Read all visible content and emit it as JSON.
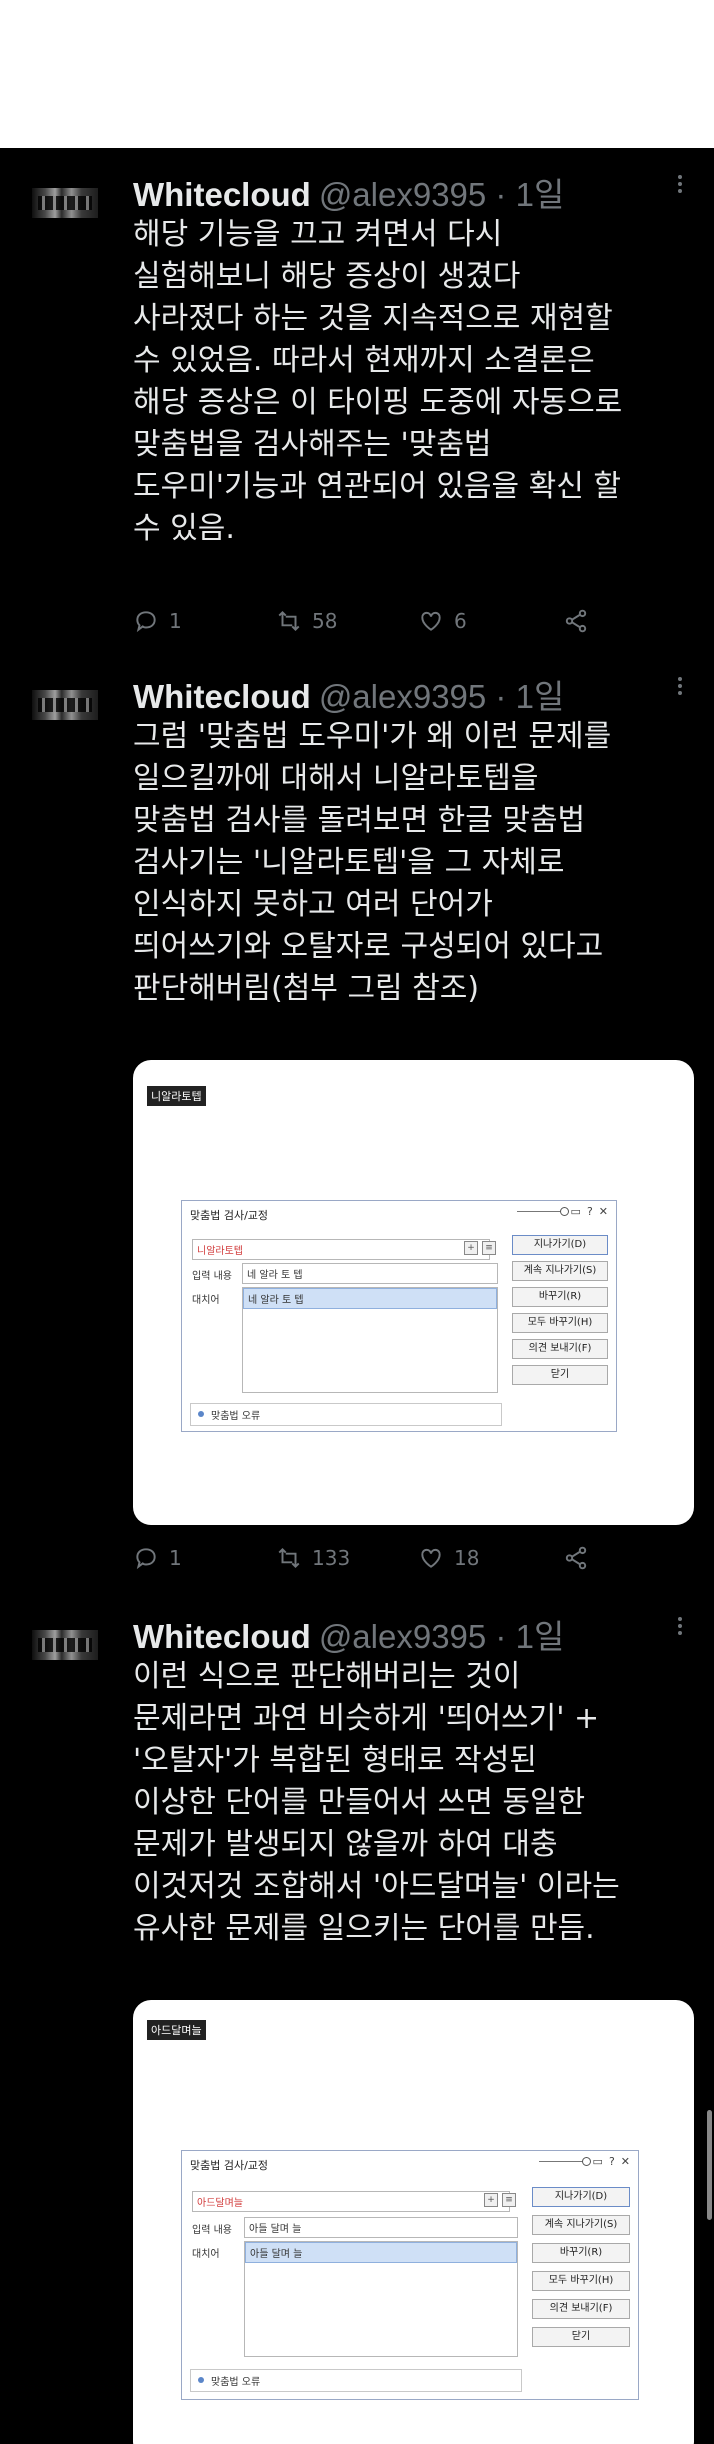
{
  "tweets": [
    {
      "name": "Whitecloud",
      "handle": "@alex9395 · 1일",
      "lines": [
        "해당 기능을 끄고 켜면서 다시",
        "실험해보니 해당 증상이 생겼다",
        "사라졌다 하는 것을 지속적으로 재현할",
        "수 있었음. 따라서 현재까지 소결론은",
        "해당 증상은 이 타이핑 도중에 자동으로",
        "맞춤법을 검사해주는 '맞춤법",
        "도우미'기능과 연관되어 있음을 확신 할",
        "수 있음."
      ],
      "replies": "1",
      "retweets": "58",
      "likes": "6"
    },
    {
      "name": "Whitecloud",
      "handle": "@alex9395 · 1일",
      "lines": [
        "그럼 '맞춤법 도우미'가 왜 이런 문제를",
        "일으킬까에 대해서 니알라토텝을",
        "맞춤법 검사를 돌려보면 한글 맞춤법",
        "검사기는 '니알라토텝'을 그 자체로",
        "인식하지 못하고 여러 단어가",
        "띄어쓰기와 오탈자로 구성되어 있다고",
        "판단해버림(첨부 그림 참조)"
      ],
      "replies": "1",
      "retweets": "133",
      "likes": "18",
      "attachment": {
        "tag": "니알라토텝",
        "dialog": {
          "title": "맞춤법 검사/교정",
          "word": "니알라토텝",
          "input_label": "입력 내용",
          "input_value": "네 알라 토 텝",
          "replace_label": "대치어",
          "replace_value": "네 알라 토 텝",
          "status": "맞춤법 오류",
          "buttons": [
            "지나가기(D)",
            "계속 지나가기(S)",
            "바꾸기(R)",
            "모두 바꾸기(H)",
            "의견 보내기(F)",
            "닫기"
          ]
        }
      }
    },
    {
      "name": "Whitecloud",
      "handle": "@alex9395 · 1일",
      "lines": [
        "이런 식으로 판단해버리는 것이",
        "문제라면 과연 비슷하게 '띄어쓰기' +",
        "'오탈자'가 복합된 형태로 작성된",
        "이상한 단어를 만들어서 쓰면 동일한",
        "문제가 발생되지 않을까 하여 대충",
        "이것저것 조합해서 '아드달며늘' 이라는",
        "유사한 문제를 일으키는 단어를 만듬."
      ],
      "attachment": {
        "tag": "아드달며늘",
        "dialog": {
          "title": "맞춤법 검사/교정",
          "word": "아드달며늘",
          "input_label": "입력 내용",
          "input_value": "아들 달며 늘",
          "replace_label": "대치어",
          "replace_value": "아들 달며 늘",
          "status": "맞춤법 오류",
          "buttons": [
            "지나가기(D)",
            "계속 지나가기(S)",
            "바꾸기(R)",
            "모두 바꾸기(H)",
            "의견 보내기(F)",
            "닫기"
          ]
        }
      }
    }
  ],
  "icons": {
    "reply": "reply-icon",
    "retweet": "retweet-icon",
    "like": "heart-icon",
    "share": "share-icon",
    "more": "more-icon"
  },
  "colors": {
    "background": "#000000",
    "text": "#e7e9ea",
    "muted": "#71767b"
  }
}
